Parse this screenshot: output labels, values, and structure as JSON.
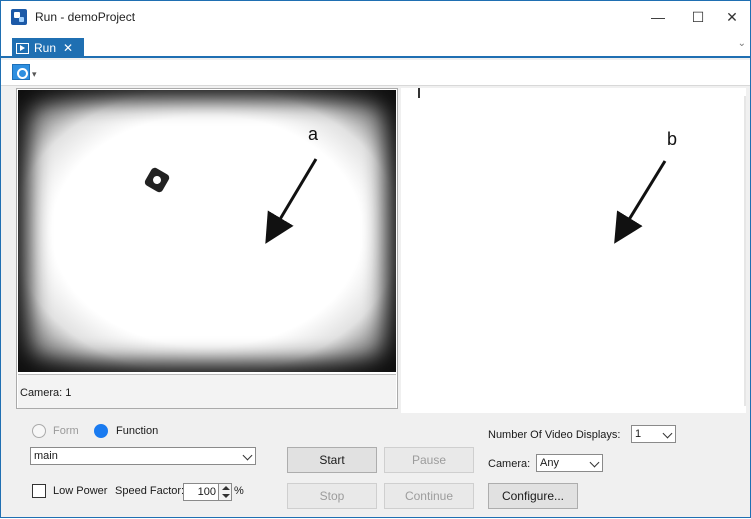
{
  "window": {
    "title": "Run - demoProject",
    "minimize_glyph": "—",
    "maximize_glyph": "☐",
    "close_glyph": "✕"
  },
  "tabs": [
    {
      "label": "Run",
      "close_glyph": "✕"
    }
  ],
  "tab_overflow_glyph": "⌄",
  "toolbar": {
    "camera_icon": "camera-icon",
    "dropdown_glyph": "▾"
  },
  "video": {
    "camera_label": "Camera: 1"
  },
  "annotations": {
    "a": "a",
    "b": "b"
  },
  "controls": {
    "mode_options": [
      {
        "label": "Form",
        "checked": false,
        "enabled": false
      },
      {
        "label": "Function",
        "checked": true,
        "enabled": true
      }
    ],
    "function_select": "main",
    "start_label": "Start",
    "pause_label": "Pause",
    "stop_label": "Stop",
    "continue_label": "Continue",
    "low_power_label": "Low Power",
    "low_power_checked": false,
    "speed_factor_label": "Speed Factor:",
    "speed_factor_value": "100",
    "speed_factor_unit": "%",
    "num_video_displays_label": "Number Of Video Displays:",
    "num_video_displays_value": "1",
    "camera_label": "Camera:",
    "camera_value": "Any",
    "configure_label": "Configure..."
  },
  "colors": {
    "accent": "#1f6fb2",
    "radio_selected": "#1a7bf0"
  }
}
